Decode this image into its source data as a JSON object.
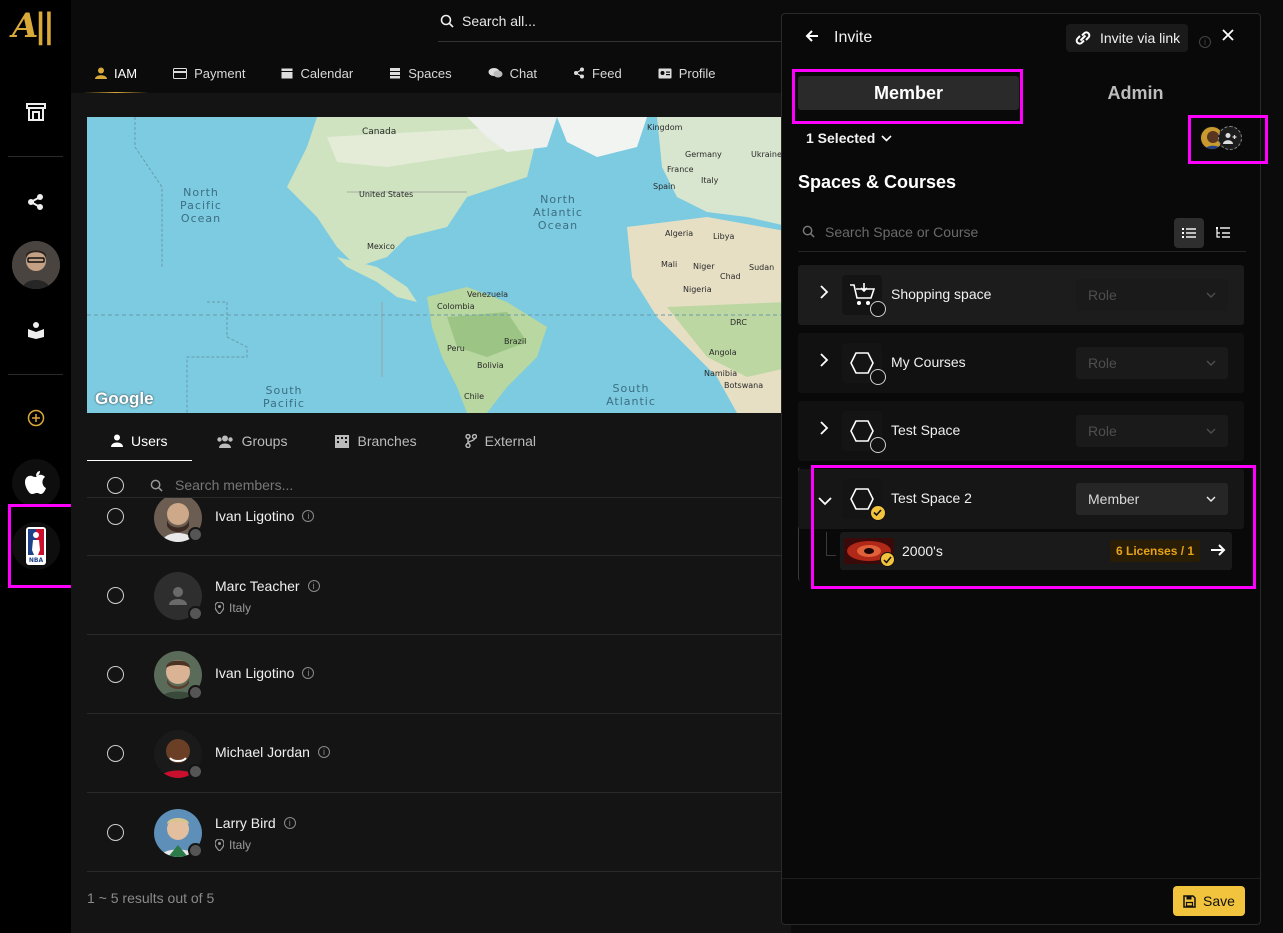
{
  "search": {
    "placeholder": "Search all..."
  },
  "nav": {
    "tabs": [
      {
        "label": "IAM",
        "icon": "user-icon",
        "active": true
      },
      {
        "label": "Payment",
        "icon": "card-icon"
      },
      {
        "label": "Calendar",
        "icon": "calendar-icon"
      },
      {
        "label": "Spaces",
        "icon": "stack-icon"
      },
      {
        "label": "Chat",
        "icon": "chat-icon"
      },
      {
        "label": "Feed",
        "icon": "share-icon"
      },
      {
        "label": "Profile",
        "icon": "id-card-icon"
      }
    ]
  },
  "map": {
    "labels": {
      "canada": "Canada",
      "united_states": "United States",
      "mexico": "Mexico",
      "north_pacific": "North\nPacific\nOcean",
      "north_atlantic": "North\nAtlantic\nOcean",
      "south_pacific": "South\nPacific",
      "south_atlantic": "South\nAtlantic",
      "venezuela": "Venezuela",
      "colombia": "Colombia",
      "peru": "Peru",
      "brazil": "Brazil",
      "bolivia": "Bolivia",
      "chile": "Chile",
      "kingdom": "Kingdom",
      "germany": "Germany",
      "france": "France",
      "ukraine": "Ukraine",
      "spain": "Spain",
      "italy": "Italy",
      "algeria": "Algeria",
      "libya": "Libya",
      "mali": "Mali",
      "niger": "Niger",
      "chad": "Chad",
      "sudan": "Sudan",
      "nigeria": "Nigeria",
      "drc": "DRC",
      "angola": "Angola",
      "namibia": "Namibia",
      "botswana": "Botswana",
      "google": "Google"
    }
  },
  "users_tabs": [
    {
      "label": "Users",
      "icon": "user-icon",
      "active": true
    },
    {
      "label": "Groups",
      "icon": "users-icon"
    },
    {
      "label": "Branches",
      "icon": "building-icon"
    },
    {
      "label": "External",
      "icon": "branch-icon"
    }
  ],
  "member_search": {
    "placeholder": "Search members..."
  },
  "users": [
    {
      "name": "Ivan Ligotino",
      "location": ""
    },
    {
      "name": "Marc Teacher",
      "location": "Italy"
    },
    {
      "name": "Ivan Ligotino",
      "location": ""
    },
    {
      "name": "Michael Jordan",
      "location": ""
    },
    {
      "name": "Larry Bird",
      "location": "Italy"
    }
  ],
  "results_text": "1 ~ 5 results out of 5",
  "invite": {
    "title": "Invite",
    "invite_link_label": "Invite via link",
    "tabs": {
      "member": "Member",
      "admin": "Admin"
    },
    "selected_label": "1 Selected",
    "section_title": "Spaces & Courses",
    "course_search_placeholder": "Search Space or Course",
    "spaces": [
      {
        "name": "Shopping space",
        "role": "Role",
        "icon": "cart-icon"
      },
      {
        "name": "My Courses",
        "role": "Role",
        "icon": "hexagon-icon"
      },
      {
        "name": "Test Space",
        "role": "Role",
        "icon": "hexagon-icon"
      },
      {
        "name": "Test Space 2",
        "role": "Member",
        "icon": "hexagon-icon",
        "expanded": true
      }
    ],
    "course": {
      "name": "2000's",
      "licenses": "6 Licenses / 1"
    },
    "save_label": "Save"
  },
  "colors": {
    "accent": "#f2c33c",
    "highlight": "#ff00ff",
    "license_text": "#e6a31a"
  }
}
